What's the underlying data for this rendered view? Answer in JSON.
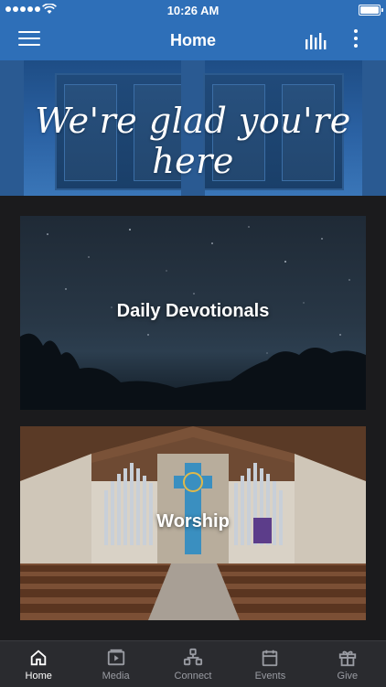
{
  "status_bar": {
    "time": "10:26 AM"
  },
  "nav": {
    "title": "Home",
    "icons": [
      "menu-icon",
      "audio-bars-icon",
      "more-vertical-icon"
    ]
  },
  "hero": {
    "tagline": "We're glad you're here"
  },
  "cards": [
    {
      "label": "Daily Devotionals"
    },
    {
      "label": "Worship"
    }
  ],
  "tabs": [
    {
      "label": "Home",
      "icon": "home-icon",
      "active": true
    },
    {
      "label": "Media",
      "icon": "media-play-icon",
      "active": false
    },
    {
      "label": "Connect",
      "icon": "connect-people-icon",
      "active": false
    },
    {
      "label": "Events",
      "icon": "calendar-icon",
      "active": false
    },
    {
      "label": "Give",
      "icon": "gift-icon",
      "active": false
    }
  ],
  "colors": {
    "primary": "#2e6fb8",
    "background": "#1b1b1d",
    "tabbar": "#2a2b2f",
    "tab_inactive": "#9a9ca3",
    "tab_active": "#ffffff"
  }
}
